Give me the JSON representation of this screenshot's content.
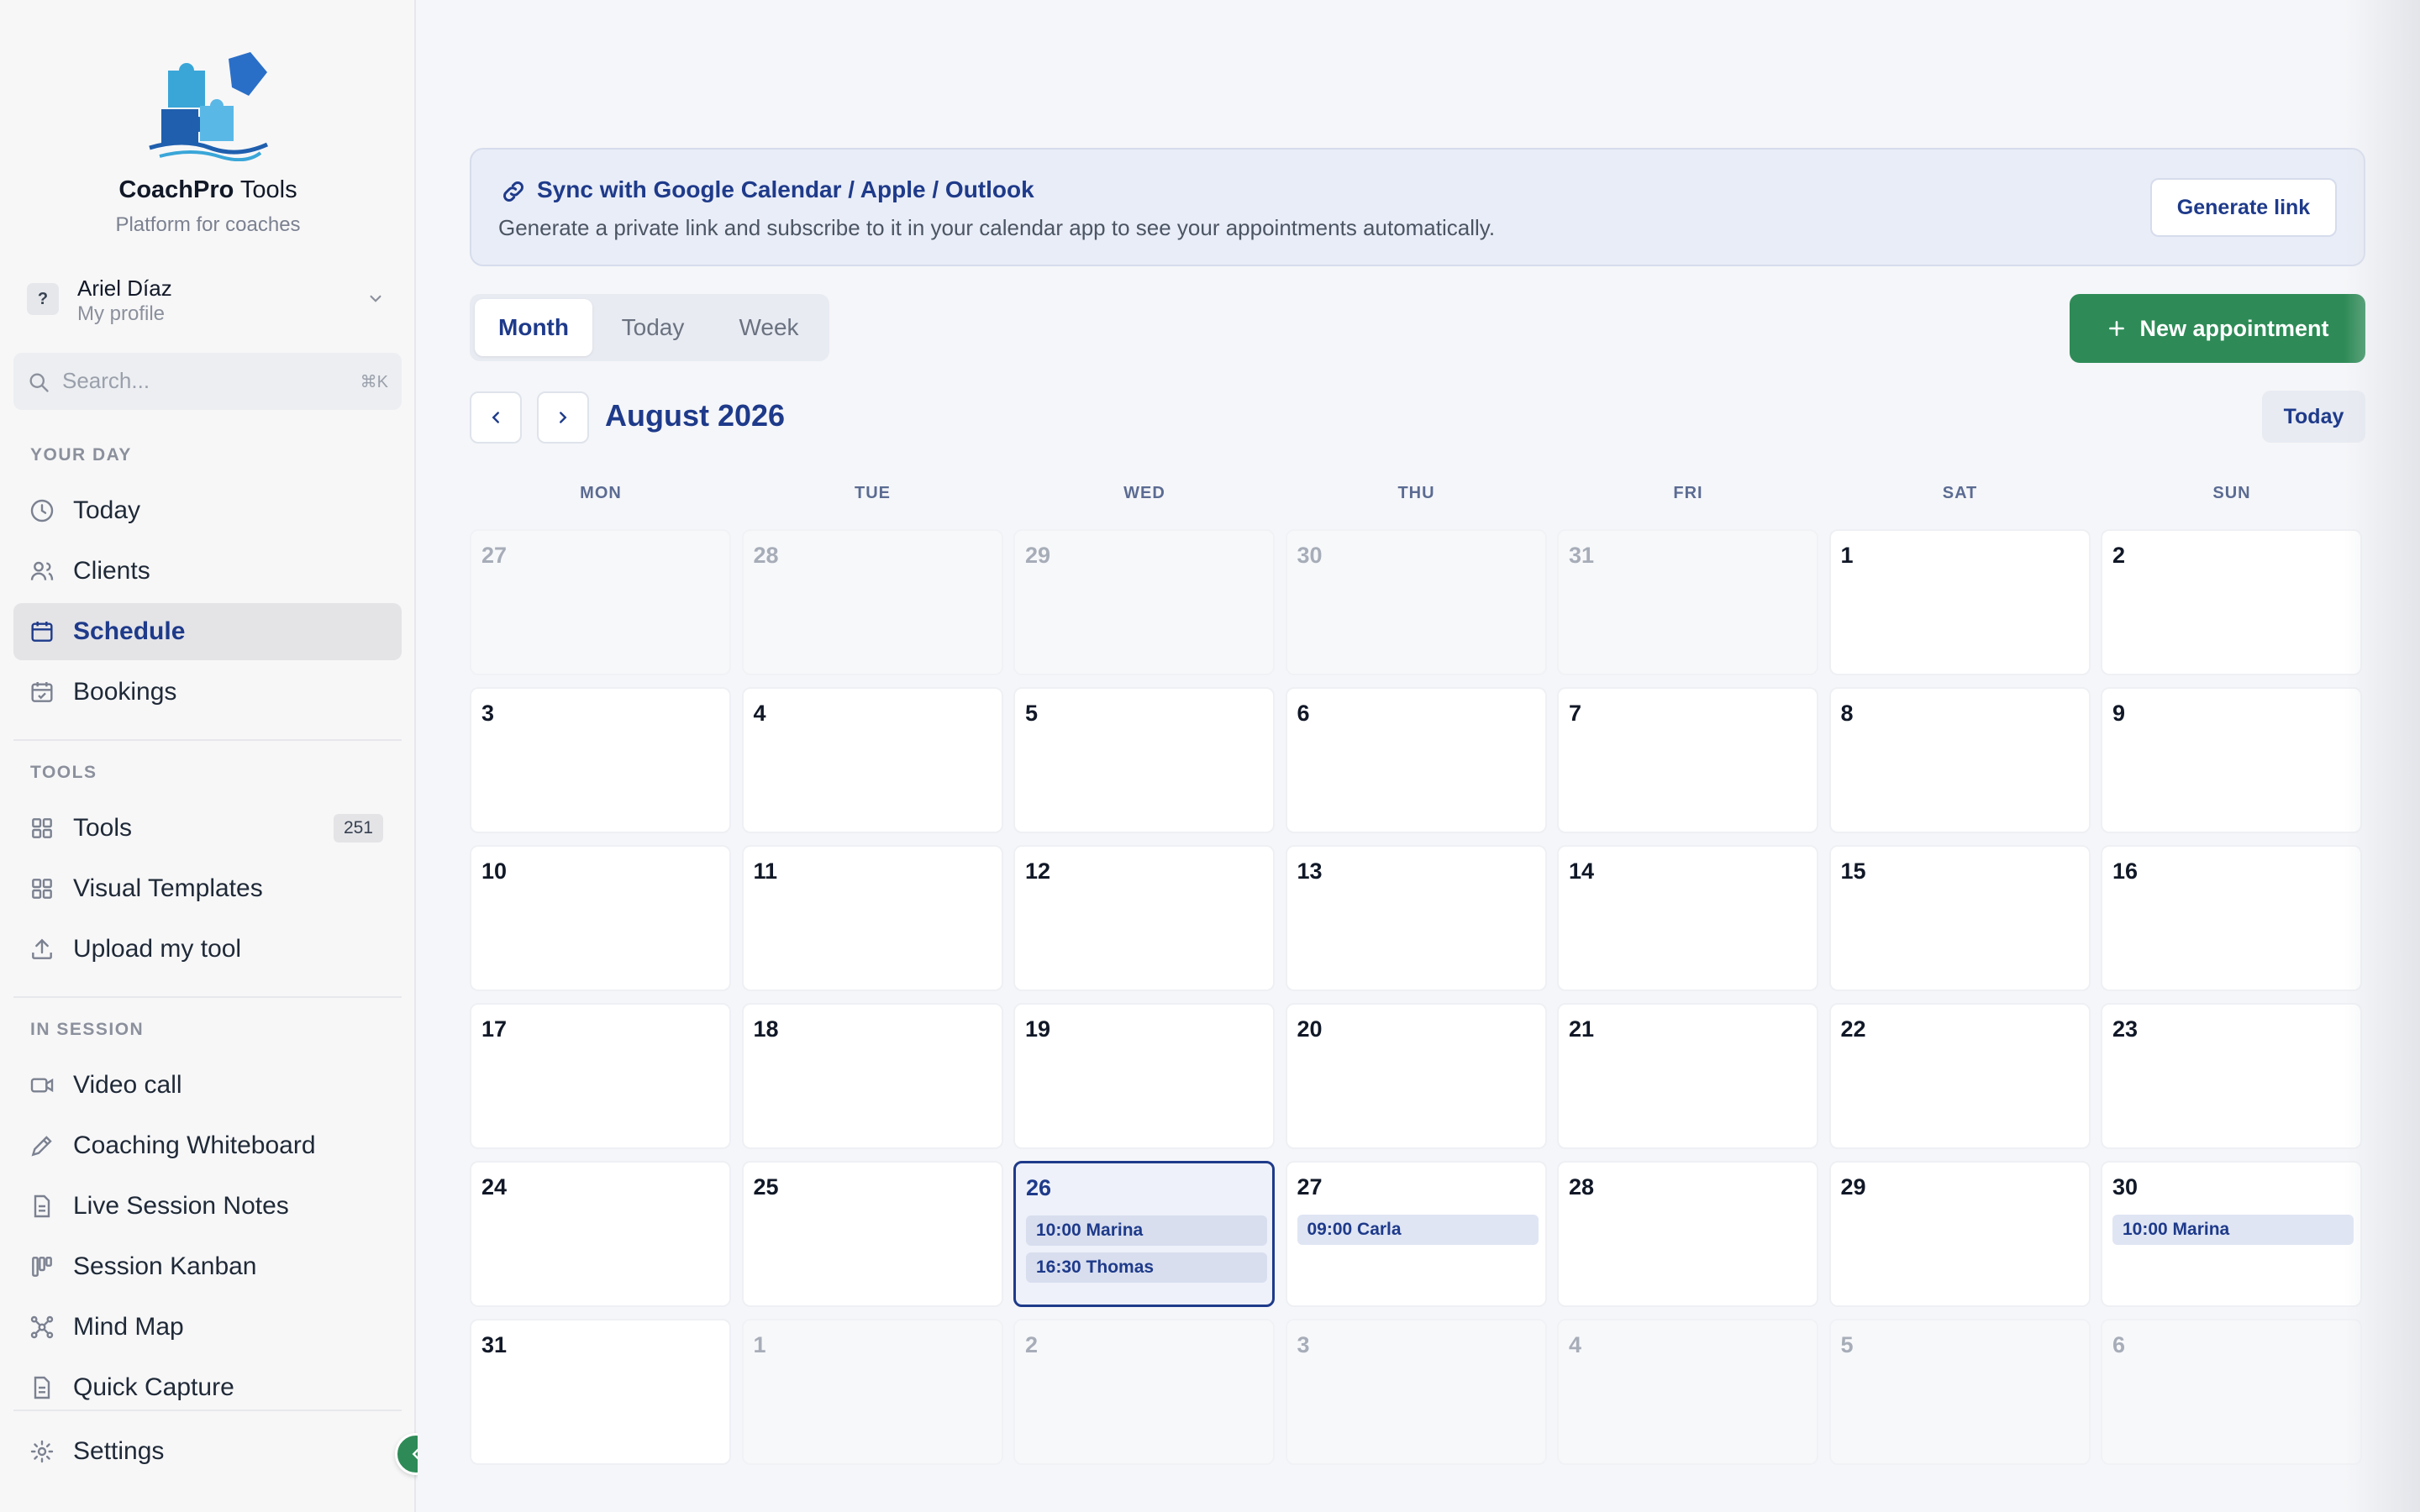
{
  "brand": {
    "name_bold": "CoachPro",
    "name_rest": " Tools",
    "tagline": "Platform for coaches"
  },
  "profile": {
    "avatar": "?",
    "name": "Ariel Díaz",
    "sub": "My profile"
  },
  "search": {
    "placeholder": "Search...",
    "shortcut": "⌘K"
  },
  "sidebar": {
    "sections": [
      "YOUR DAY",
      "TOOLS",
      "IN SESSION"
    ],
    "your_day": [
      {
        "label": "Today",
        "icon": "clock-icon"
      },
      {
        "label": "Clients",
        "icon": "users-icon"
      },
      {
        "label": "Schedule",
        "icon": "calendar-icon"
      },
      {
        "label": "Bookings",
        "icon": "calendar-check-icon"
      }
    ],
    "tools": [
      {
        "label": "Tools",
        "icon": "grid-icon",
        "badge": "251"
      },
      {
        "label": "Visual Templates",
        "icon": "grid-icon"
      },
      {
        "label": "Upload my tool",
        "icon": "upload-icon"
      }
    ],
    "in_session": [
      {
        "label": "Video call",
        "icon": "video-icon"
      },
      {
        "label": "Coaching Whiteboard",
        "icon": "pen-icon"
      },
      {
        "label": "Live Session Notes",
        "icon": "file-icon"
      },
      {
        "label": "Session Kanban",
        "icon": "kanban-icon"
      },
      {
        "label": "Mind Map",
        "icon": "mindmap-icon"
      },
      {
        "label": "Quick Capture",
        "icon": "file-icon"
      }
    ],
    "settings": "Settings"
  },
  "sync": {
    "title": "Sync with Google Calendar / Apple / Outlook",
    "desc": "Generate a private link and subscribe to it in your calendar app to see your appointments automatically.",
    "button": "Generate link"
  },
  "view_tabs": [
    "Month",
    "Today",
    "Week"
  ],
  "new_appointment": "New appointment",
  "calendar": {
    "month_title": "August 2026",
    "today_button": "Today",
    "weekdays": [
      "MON",
      "TUE",
      "WED",
      "THU",
      "FRI",
      "SAT",
      "SUN"
    ],
    "weeks": [
      [
        {
          "d": "27",
          "out": true
        },
        {
          "d": "28",
          "out": true
        },
        {
          "d": "29",
          "out": true
        },
        {
          "d": "30",
          "out": true
        },
        {
          "d": "31",
          "out": true
        },
        {
          "d": "1"
        },
        {
          "d": "2"
        }
      ],
      [
        {
          "d": "3"
        },
        {
          "d": "4"
        },
        {
          "d": "5"
        },
        {
          "d": "6"
        },
        {
          "d": "7"
        },
        {
          "d": "8"
        },
        {
          "d": "9"
        }
      ],
      [
        {
          "d": "10"
        },
        {
          "d": "11"
        },
        {
          "d": "12"
        },
        {
          "d": "13"
        },
        {
          "d": "14"
        },
        {
          "d": "15"
        },
        {
          "d": "16"
        }
      ],
      [
        {
          "d": "17"
        },
        {
          "d": "18"
        },
        {
          "d": "19"
        },
        {
          "d": "20"
        },
        {
          "d": "21"
        },
        {
          "d": "22"
        },
        {
          "d": "23"
        }
      ],
      [
        {
          "d": "24"
        },
        {
          "d": "25"
        },
        {
          "d": "26",
          "today": true,
          "events": [
            "10:00 Marina",
            "16:30 Thomas"
          ]
        },
        {
          "d": "27",
          "events": [
            "09:00 Carla"
          ]
        },
        {
          "d": "28"
        },
        {
          "d": "29"
        },
        {
          "d": "30",
          "events": [
            "10:00 Marina"
          ]
        }
      ],
      [
        {
          "d": "31"
        },
        {
          "d": "1",
          "out": true
        },
        {
          "d": "2",
          "out": true
        },
        {
          "d": "3",
          "out": true
        },
        {
          "d": "4",
          "out": true
        },
        {
          "d": "5",
          "out": true
        },
        {
          "d": "6",
          "out": true
        }
      ]
    ]
  },
  "colors": {
    "accent": "#1e3a8a",
    "green": "#2e8b57"
  }
}
